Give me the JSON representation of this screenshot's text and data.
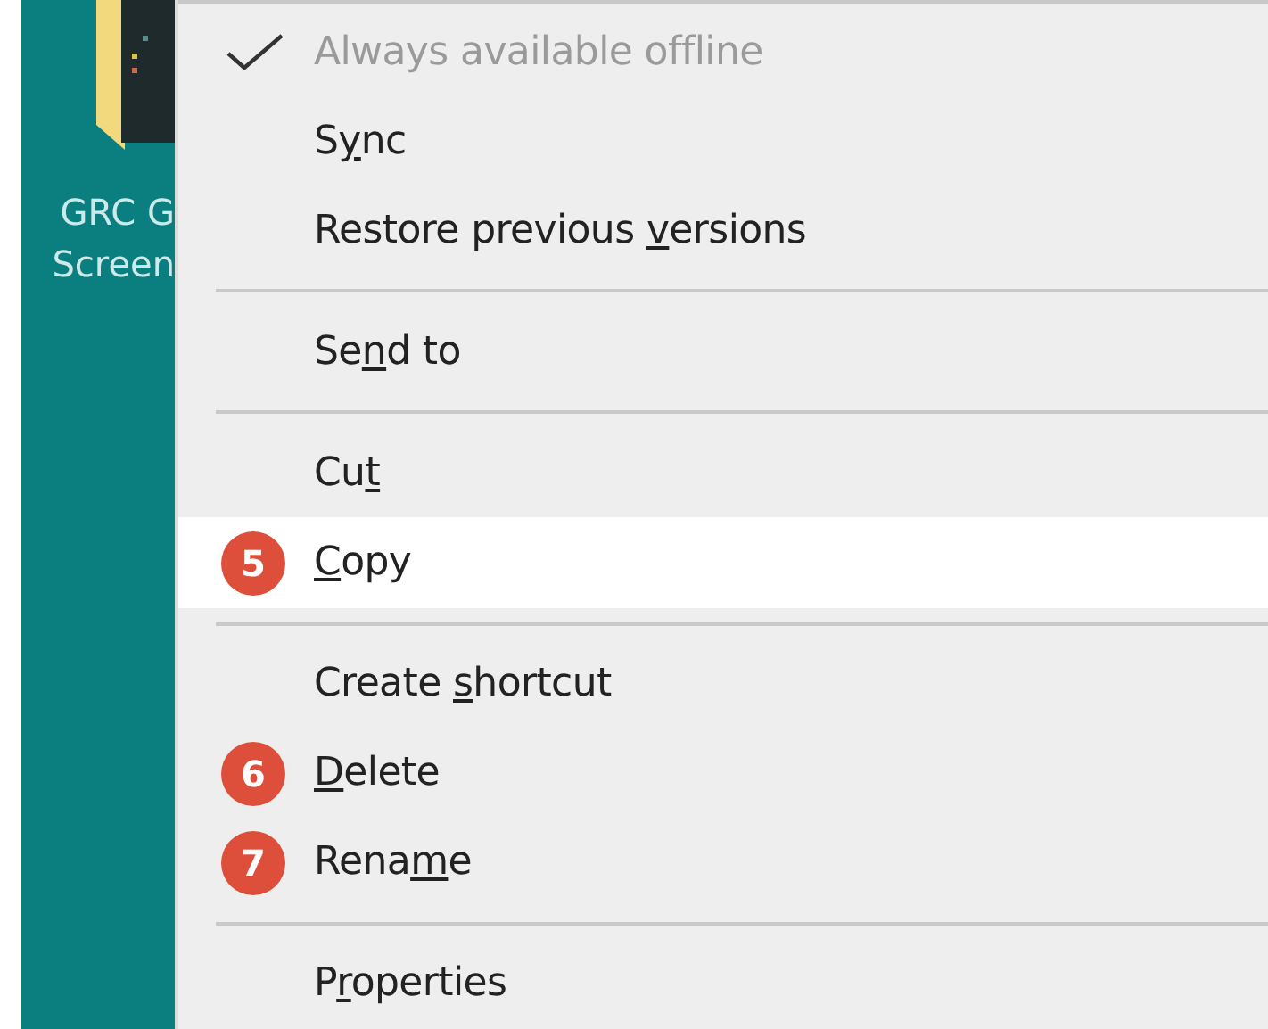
{
  "desktop": {
    "icon_label": [
      "GRC G",
      "Screen"
    ]
  },
  "menu": {
    "items": [
      {
        "kind": "item",
        "before": "Always available offline",
        "checked": true,
        "disabled": true,
        "selected": false
      },
      {
        "kind": "item",
        "before": "S",
        "key": "y",
        "after": "nc",
        "checked": false,
        "disabled": false,
        "selected": false
      },
      {
        "kind": "item",
        "before": "Restore previous ",
        "key": "v",
        "after": "ersions",
        "checked": false,
        "disabled": false,
        "selected": false
      },
      {
        "kind": "separator"
      },
      {
        "kind": "item",
        "before": "Se",
        "key": "n",
        "after": "d to",
        "checked": false,
        "disabled": false,
        "selected": false
      },
      {
        "kind": "separator"
      },
      {
        "kind": "item",
        "before": "Cu",
        "key": "t",
        "checked": false,
        "disabled": false,
        "selected": false
      },
      {
        "kind": "item",
        "key": "C",
        "after": "opy",
        "checked": false,
        "disabled": false,
        "selected": true,
        "badge": "5"
      },
      {
        "kind": "separator"
      },
      {
        "kind": "item",
        "before": "Create ",
        "key": "s",
        "after": "hortcut",
        "checked": false,
        "disabled": false,
        "selected": false
      },
      {
        "kind": "item",
        "key": "D",
        "after": "elete",
        "checked": false,
        "disabled": false,
        "selected": false,
        "badge": "6"
      },
      {
        "kind": "item",
        "before": "Rena",
        "key": "m",
        "after": "e",
        "checked": false,
        "disabled": false,
        "selected": false,
        "badge": "7"
      },
      {
        "kind": "separator"
      },
      {
        "kind": "item",
        "before": "P",
        "key": "r",
        "after": "operties",
        "checked": false,
        "disabled": false,
        "selected": false
      }
    ]
  }
}
